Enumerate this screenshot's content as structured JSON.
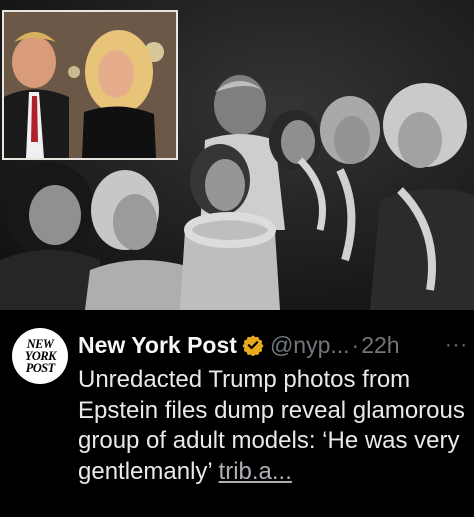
{
  "photo": {
    "main_icon": "group-photo",
    "inset_icon": "couple-photo"
  },
  "tweet": {
    "avatar_lines": [
      "New",
      "York",
      "Post"
    ],
    "display_name": "New York Post",
    "verified_icon": "gold-verified-badge-icon",
    "handle": "@nyp...",
    "separator": "·",
    "time": "22h",
    "more": "···",
    "body": "Unredacted Trump photos from Epstein files dump reveal glamorous group of adult models: ‘He was very gentlemanly’",
    "link": "trib.a..."
  },
  "colors": {
    "background": "#000000",
    "name": "#f7f9f9",
    "handle": "#71767b",
    "badge": "#e8a91d",
    "body": "#e7e9ea"
  }
}
